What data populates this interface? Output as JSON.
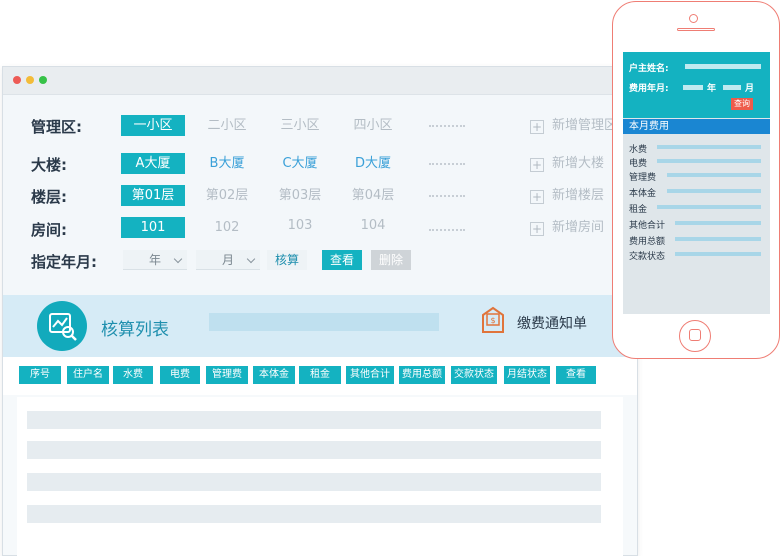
{
  "filters": {
    "district": {
      "label": "管理区:",
      "options": [
        "一小区",
        "二小区",
        "三小区",
        "四小区"
      ],
      "add_label": "新增管理区"
    },
    "building": {
      "label": "大楼:",
      "options": [
        "A大厦",
        "B大厦",
        "C大厦",
        "D大厦"
      ],
      "add_label": "新增大楼"
    },
    "floor": {
      "label": "楼层:",
      "options": [
        "第01层",
        "第02层",
        "第03层",
        "第04层"
      ],
      "add_label": "新增楼层"
    },
    "room": {
      "label": "房间:",
      "options": [
        "101",
        "102",
        "103",
        "104"
      ],
      "add_label": "新增房间"
    },
    "period": {
      "label": "指定年月:",
      "year_select": "年",
      "month_select": "月",
      "calc_label": "核算",
      "view_label": "查看",
      "delete_label": "删除"
    }
  },
  "calc": {
    "title": "核算列表",
    "notice_label": "缴费通知单"
  },
  "columns": [
    "序号",
    "住户名",
    "水费",
    "电费",
    "管理费",
    "本体金",
    "租金",
    "其他合计",
    "费用总额",
    "交款状态",
    "月结状态",
    "查看"
  ],
  "phone": {
    "owner_label": "户主姓名:",
    "period_label": "费用年月:",
    "year": "年",
    "month": "月",
    "query_label": "查询",
    "section_title": "本月费用",
    "items": [
      "水费",
      "电费",
      "管理费",
      "本体金",
      "租金",
      "其他合计",
      "费用总额",
      "交款状态"
    ]
  },
  "colors": {
    "accent": "#14b2c1",
    "section_blue": "#1a86d2",
    "phone_frame": "#ef7d74",
    "query_red": "#ee5b4b"
  }
}
